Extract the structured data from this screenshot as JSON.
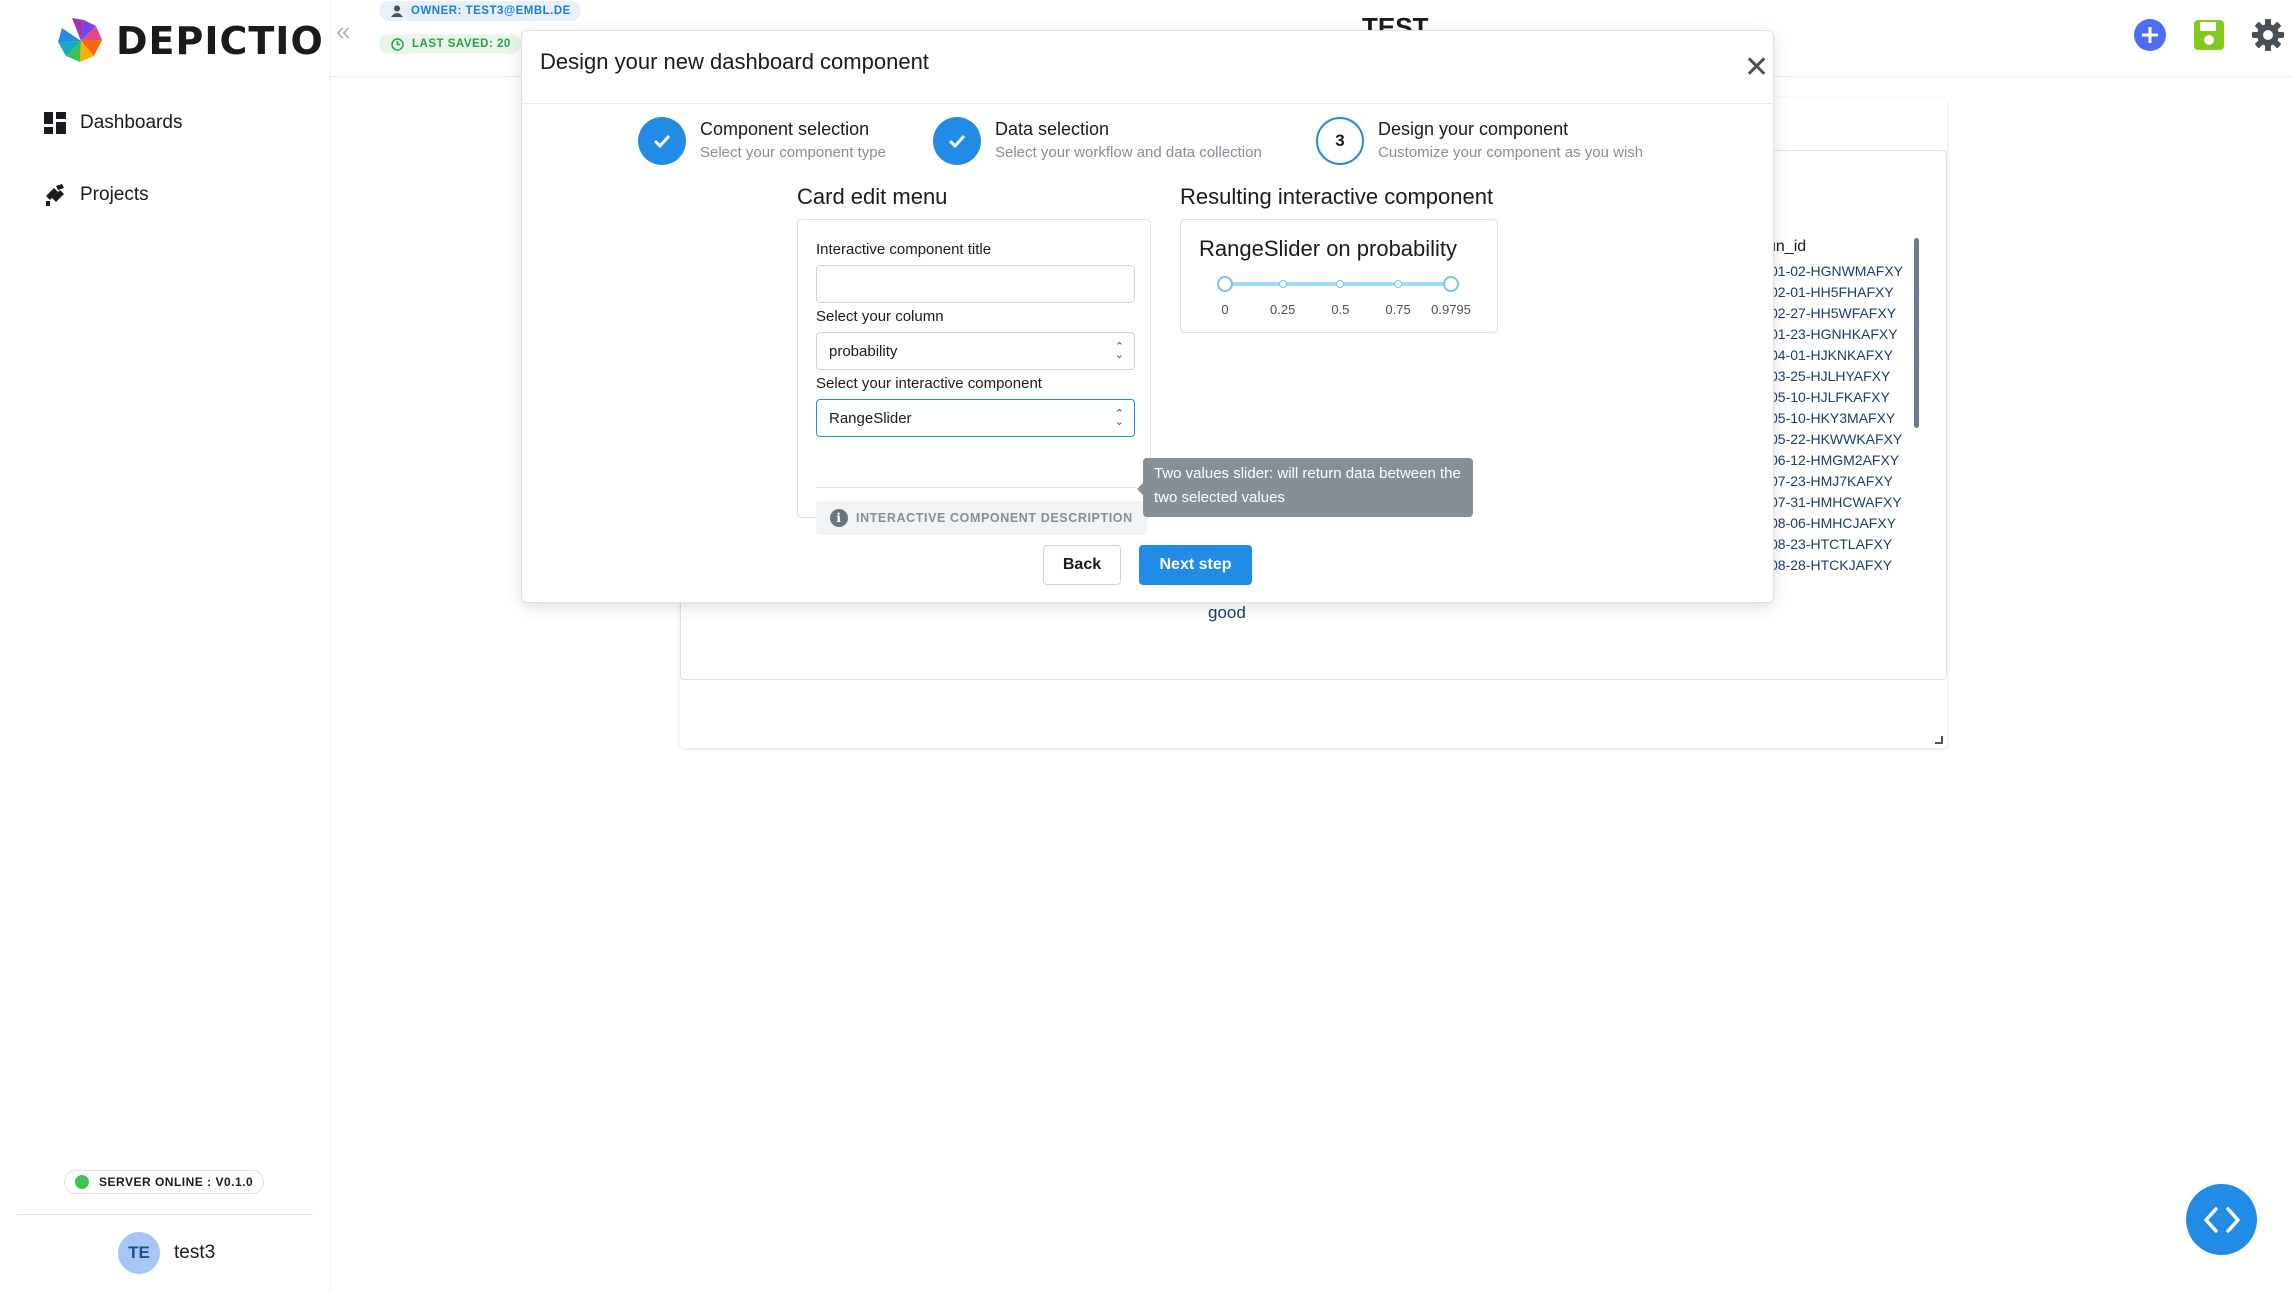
{
  "brand": {
    "name": "DEPICTIO"
  },
  "sidebar": {
    "items": [
      {
        "label": "Dashboards",
        "icon": "dashboard-icon"
      },
      {
        "label": "Projects",
        "icon": "projects-icon"
      }
    ],
    "server_status": "SERVER ONLINE : V0.1.0",
    "user": {
      "initials": "TE",
      "name": "test3"
    }
  },
  "header": {
    "owner_badge": "OWNER: TEST3@EMBL.DE",
    "saved_badge": "LAST SAVED: 20",
    "title": "TEST"
  },
  "background_table": {
    "column_header": "un_id",
    "rows": [
      "01-02-HGNWMAFXY",
      "02-01-HH5FHAFXY",
      "02-27-HH5WFAFXY",
      "01-23-HGNHKAFXY",
      "04-01-HJKNKAFXY",
      "03-25-HJLHYAFXY",
      "05-10-HJLFKAFXY",
      "05-10-HKY3MAFXY",
      "05-22-HKWWKAFXY",
      "06-12-HMGM2AFXY",
      "07-23-HMJ7KAFXY",
      "07-31-HMHCWAFXY",
      "08-06-HMHCJAFXY",
      "08-23-HTCTLAFXY",
      "08-28-HTCKJAFXY"
    ],
    "extra_value": "good"
  },
  "modal": {
    "title": "Design your new dashboard component",
    "steps": [
      {
        "title": "Component selection",
        "description": "Select your component type",
        "state": "done"
      },
      {
        "title": "Data selection",
        "description": "Select your workflow and data collection",
        "state": "done"
      },
      {
        "number": "3",
        "title": "Design your component",
        "description": "Customize your component as you wish",
        "state": "active"
      }
    ],
    "edit_menu": {
      "heading": "Card edit menu",
      "title_label": "Interactive component title",
      "title_value": "",
      "column_label": "Select your column",
      "column_value": "probability",
      "component_label": "Select your interactive component",
      "component_value": "RangeSlider",
      "description_button": "INTERACTIVE COMPONENT DESCRIPTION",
      "tooltip": "Two values slider: will return data between the two selected values"
    },
    "result": {
      "heading": "Resulting interactive component",
      "component_title": "RangeSlider on probability",
      "slider": {
        "min": 0,
        "max": 0.9795,
        "selected": [
          0,
          0.9795
        ],
        "marks": [
          {
            "value": 0,
            "label": "0"
          },
          {
            "value": 0.25,
            "label": "0.25"
          },
          {
            "value": 0.5,
            "label": "0.5"
          },
          {
            "value": 0.75,
            "label": "0.75"
          },
          {
            "value": 0.9795,
            "label": "0.9795"
          }
        ]
      }
    },
    "buttons": {
      "back": "Back",
      "next": "Next step"
    }
  },
  "colors": {
    "accent": "#228be6",
    "save": "#82c91e",
    "add": "#4c6ef5",
    "online": "#40c057"
  }
}
